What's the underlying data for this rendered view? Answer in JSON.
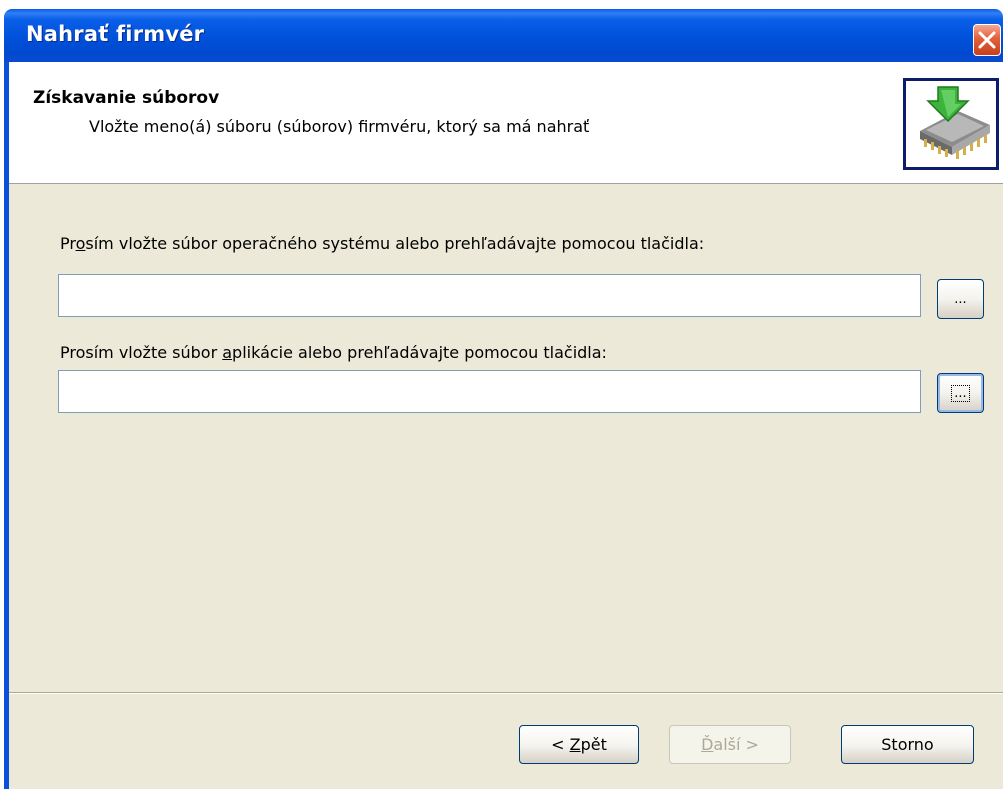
{
  "window": {
    "title": "Nahrať firmvér",
    "close_icon": "close-icon",
    "close_color": "#e2603c",
    "title_color": "#0051d9"
  },
  "header": {
    "title": "Získavanie súborov",
    "subtitle": "Vložte meno(á) súboru (súborov) firmvéru, ktorý sa má nahrať",
    "icon": "firmware-chip-download-icon"
  },
  "form": {
    "os_label_pre": "Pr",
    "os_label_accel": "o",
    "os_label_post": "sím vložte súbor operačného systému alebo prehľadávajte pomocou tlačidla:",
    "os_value": "",
    "app_label_pre": "Prosím vložte súbor ",
    "app_label_accel": "a",
    "app_label_post": "plikácie alebo prehľadávajte pomocou tlačidla:",
    "app_value": "",
    "browse_label": "..."
  },
  "buttons": {
    "back_pre": "< ",
    "back_accel": "Z",
    "back_post": "pět",
    "next_accel": "Ď",
    "next_post": "alší >",
    "cancel": "Storno"
  }
}
